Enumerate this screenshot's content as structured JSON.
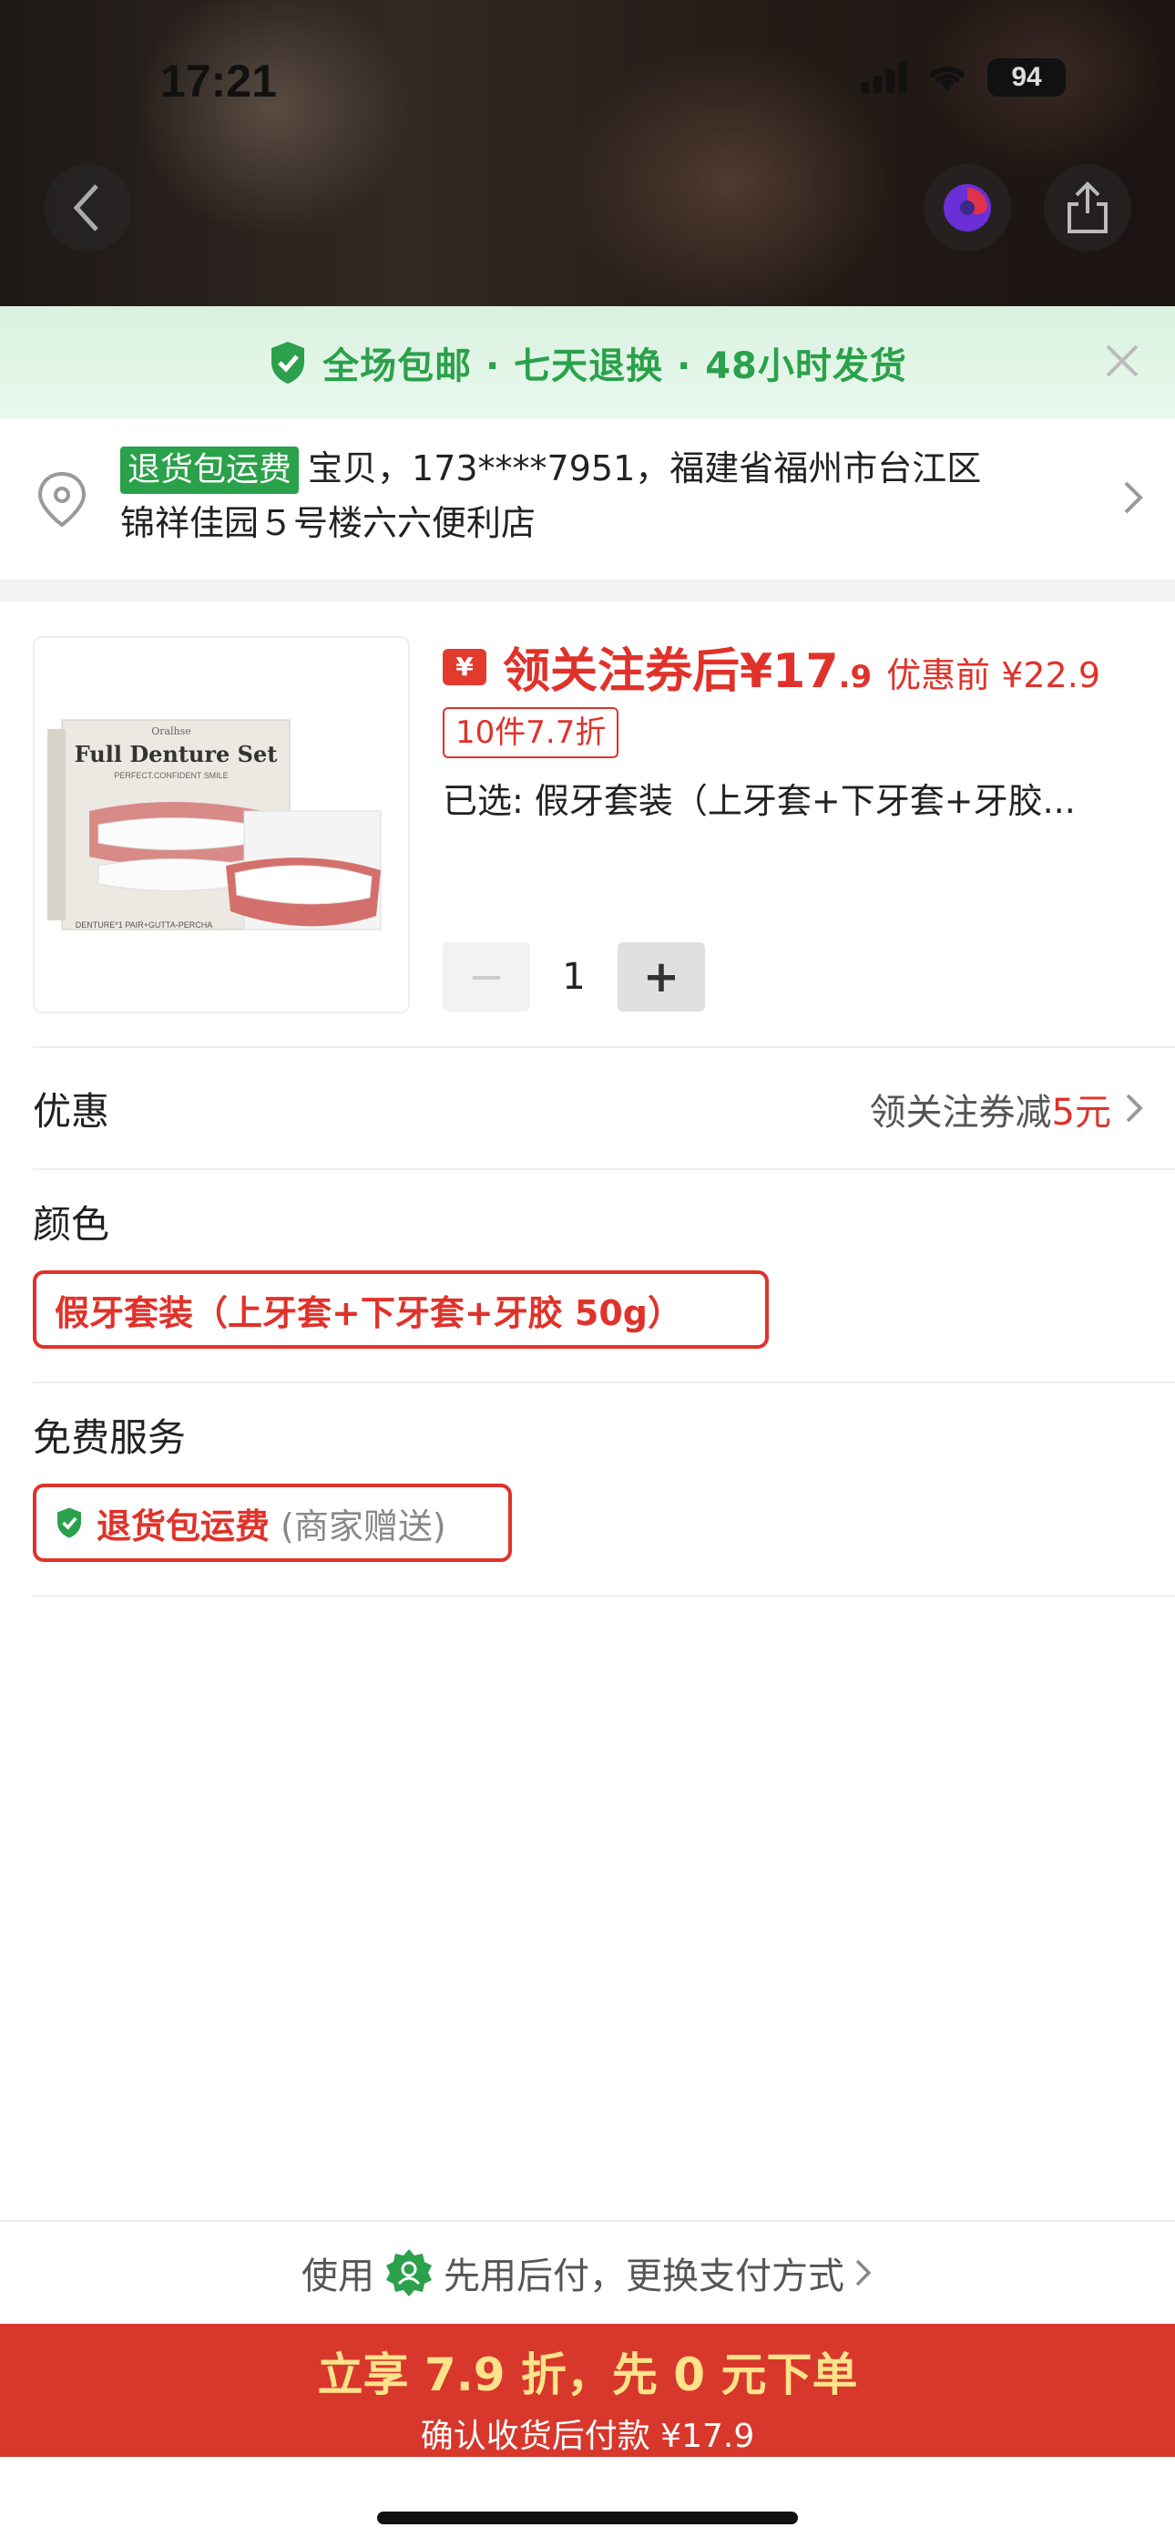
{
  "status_bar": {
    "time": "17:21",
    "battery": "94"
  },
  "hero": {
    "back_icon": "chevron-left-icon",
    "assistant_icon": "ai-orb-icon",
    "share_icon": "share-icon"
  },
  "promo_banner": {
    "text": "全场包邮 · 七天退换 · 48小时发货",
    "icon": "shield-check-icon",
    "close_icon": "close-icon",
    "color": "#2aa14a"
  },
  "address": {
    "tag": "退货包运费",
    "line1": "宝贝，173****7951，福建省福州市台江区",
    "line2": "锦祥佳园５号楼六六便利店"
  },
  "product": {
    "image_title": "Full Denture Set",
    "image_brand": "Oralhse",
    "image_tagline": "PERFECT.CONFIDENT SMILE",
    "image_footer": "DENTURE*1 PAIR+GUTTA-PERCHA",
    "coupon_icon_text": "¥",
    "price_label": "领关注券后¥17",
    "price_decimal": ".9",
    "price_before": "优惠前 ¥22.9",
    "discount_tag": "10件7.7折",
    "selected": "已选: 假牙套装（上牙套+下牙套+牙胶...",
    "quantity": "1",
    "minus": "−",
    "plus": "+"
  },
  "offer": {
    "label": "优惠",
    "value_prefix": "领关注券减",
    "value_amount": "5元"
  },
  "color": {
    "label": "颜色",
    "option": "假牙套装（上牙套+下牙套+牙胶 50g）"
  },
  "service": {
    "label": "免费服务",
    "option": "退货包运费",
    "option_note": "(商家赠送)"
  },
  "payment": {
    "prefix": "使用",
    "method": "先用后付，更换支付方式"
  },
  "cta": {
    "main": "立享 7.9 折，先 0 元下单",
    "sub": "确认收货后付款 ¥17.9",
    "color": "#d8372c"
  }
}
